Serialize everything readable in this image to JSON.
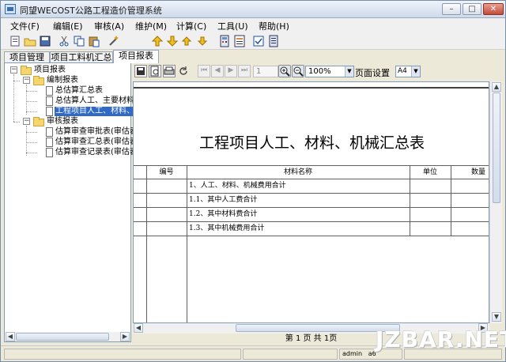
{
  "window": {
    "title": "同望WECOST公路工程造价管理系统",
    "minimize": "–",
    "maximize": "□",
    "close": "✕"
  },
  "menu": [
    {
      "label": "文件(F)"
    },
    {
      "label": "编辑(E)"
    },
    {
      "label": "审核(A)"
    },
    {
      "label": "维护(M)"
    },
    {
      "label": "计算(C)"
    },
    {
      "label": "工具(U)"
    },
    {
      "label": "帮助(H)"
    }
  ],
  "toolbar_icons": [
    "new-icon",
    "open-icon",
    "save-icon",
    "cut-icon",
    "copy-icon",
    "paste-icon",
    "wand-icon",
    "arrow-up-icon",
    "arrow-down-icon",
    "promote-icon",
    "demote-icon",
    "calculator-icon",
    "report-icon",
    "checkbox-icon",
    "form-icon"
  ],
  "tabs": [
    {
      "label": "项目管理",
      "active": false
    },
    {
      "label": "项目工料机汇总",
      "active": false
    },
    {
      "label": "项目报表",
      "active": true
    }
  ],
  "tree": {
    "root": "项目报表",
    "groups": [
      {
        "label": "编制报表",
        "items": [
          "总估算汇总表",
          "总估算人工、主要材料",
          "工程项目人工、材料、"
        ]
      },
      {
        "label": "审核报表",
        "items": [
          "估算审查审批表(审估表",
          "估算审查汇总表(审估表",
          "估算审查记录表(审估表"
        ]
      }
    ]
  },
  "viewer": {
    "page_input": "1",
    "zoom": "100%",
    "page_setup_label": "页面设置",
    "paper": "A4",
    "page_status": "第 1 页  共 1页"
  },
  "report": {
    "title": "工程项目人工、材料、机械汇总表",
    "columns": [
      "编号",
      "材料名称",
      "单位",
      "数量"
    ],
    "rows": [
      "1、人工、材料、机械费用合计",
      "1.1、其中人工费合计",
      "1.2、其中材料费合计",
      "1.3、其中机械费用合计"
    ]
  },
  "status": {
    "user": "admin",
    "extra": "a6"
  },
  "watermark": "JZBAR.NET",
  "colors": {
    "selection": "#316ac5",
    "folder": "#f4d66c",
    "window_bg": "#ece9d8"
  }
}
